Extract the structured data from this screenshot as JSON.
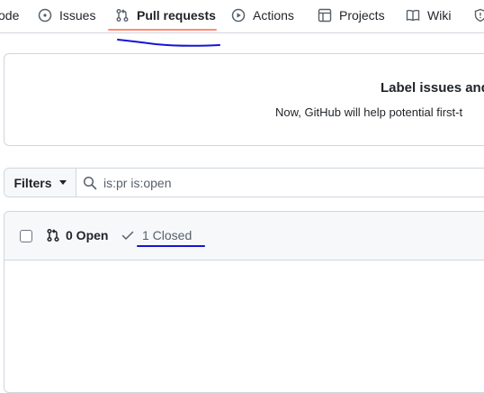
{
  "nav": {
    "tabs": [
      {
        "label": "ode",
        "icon": "code-icon"
      },
      {
        "label": "Issues",
        "icon": "issue-opened-icon"
      },
      {
        "label": "Pull requests",
        "icon": "git-pull-request-icon"
      },
      {
        "label": "Actions",
        "icon": "play-icon"
      },
      {
        "label": "Projects",
        "icon": "table-icon"
      },
      {
        "label": "Wiki",
        "icon": "book-icon"
      },
      {
        "label": "",
        "icon": "shield-icon"
      }
    ],
    "selected": "Pull requests",
    "selected_underline_color": "#fd8c73"
  },
  "banner": {
    "title": "Label issues and",
    "description": "Now, GitHub will help potential first-t"
  },
  "filters": {
    "button_label": "Filters",
    "query_value": "is:pr is:open"
  },
  "list": {
    "open_label": "0 Open",
    "closed_label": "1 Closed"
  },
  "colors": {
    "border": "#d0d7de",
    "header_bg": "#f6f8fa",
    "annotation_ink": "#1515d6"
  }
}
